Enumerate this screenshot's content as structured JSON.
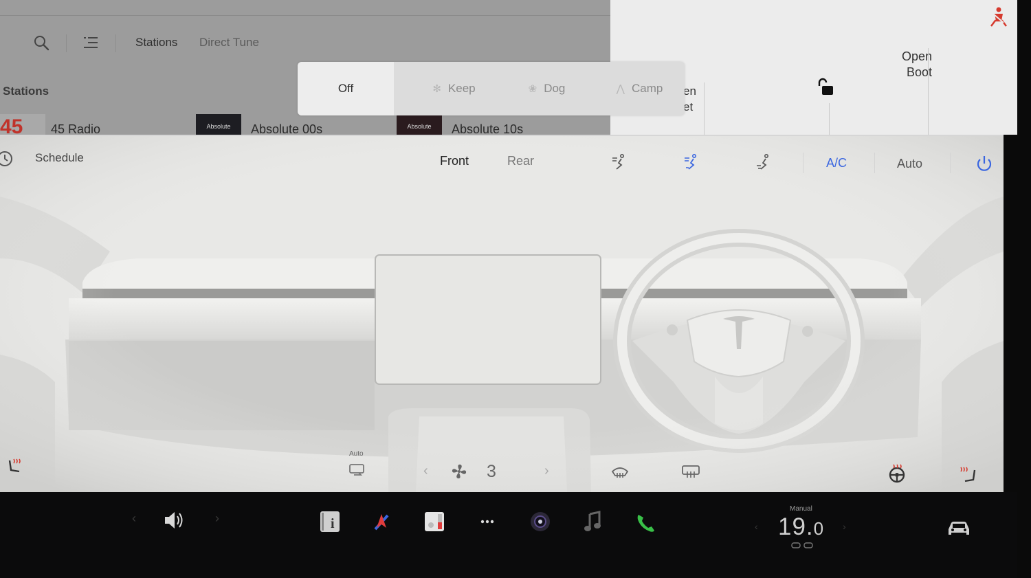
{
  "media": {
    "tabs": [
      "Stations",
      "Direct Tune"
    ],
    "section_title": "Stations",
    "stations": [
      {
        "art": "45",
        "name": "45 Radio"
      },
      {
        "art": "Absolute",
        "name": "Absolute 00s"
      },
      {
        "art": "Absolute",
        "name": "Absolute 10s"
      }
    ]
  },
  "climate_keep": {
    "options": [
      "Off",
      "Keep",
      "Dog",
      "Camp"
    ],
    "selected": "Off"
  },
  "car_controls": {
    "frunk_label_partial": "en\net",
    "boot_label": "Open\nBoot"
  },
  "climate": {
    "schedule_label": "Schedule",
    "zones": [
      "Front",
      "Rear"
    ],
    "ac_label": "A/C",
    "auto_label": "Auto",
    "recirc_label": "Auto",
    "fan_speed": "3",
    "accent_color": "#3a66e0"
  },
  "dock": {
    "temp_mode": "Manual",
    "temp_whole": "19.",
    "temp_decimal": "0"
  }
}
